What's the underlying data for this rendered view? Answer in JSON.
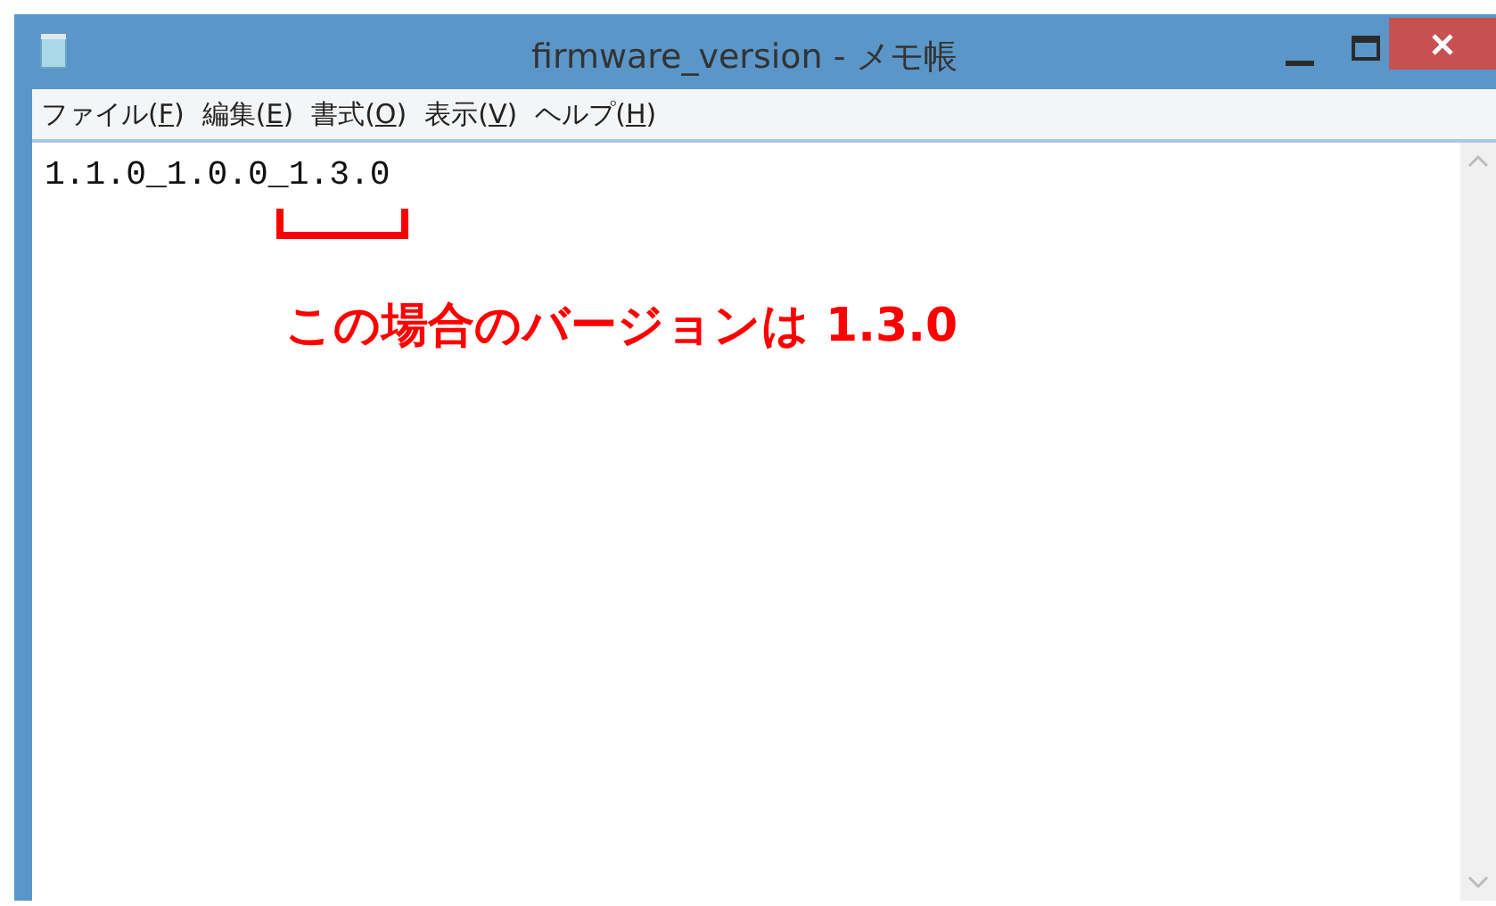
{
  "window": {
    "title": "firmware_version - メモ帳"
  },
  "menu": [
    {
      "label": "ファイル(",
      "key": "F",
      "tail": ")"
    },
    {
      "label": "編集(",
      "key": "E",
      "tail": ")"
    },
    {
      "label": "書式(",
      "key": "O",
      "tail": ")"
    },
    {
      "label": "表示(",
      "key": "V",
      "tail": ")"
    },
    {
      "label": "ヘルプ(",
      "key": "H",
      "tail": ")"
    }
  ],
  "editor": {
    "text": "1.1.0_1.0.0_1.3.0"
  },
  "annotation": {
    "text": "この場合のバージョンは 1.3.0"
  }
}
